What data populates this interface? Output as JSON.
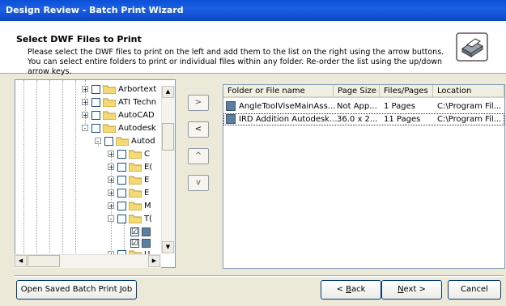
{
  "window": {
    "title": "Design Review - Batch Print Wizard"
  },
  "header": {
    "title": "Select DWF Files to Print",
    "description": "Please select the DWF files to print on the left and add them to the list on the right using the arrow buttons.  You can select entire folders to print or individual files within any folder.  Re-order the list using the up/down arrow keys.",
    "icon": "printer-icon"
  },
  "tree": {
    "items": [
      {
        "label": "Arbortext",
        "expander": "+"
      },
      {
        "label": "ATI Techn",
        "expander": "+"
      },
      {
        "label": "AutoCAD",
        "expander": "+"
      },
      {
        "label": "Autodesk",
        "expander": "-"
      },
      {
        "label": "Autod",
        "expander": "-"
      },
      {
        "label": "C",
        "expander": "+"
      },
      {
        "label": "E(",
        "expander": "+"
      },
      {
        "label": "E",
        "expander": "+"
      },
      {
        "label": "E",
        "expander": "+"
      },
      {
        "label": "M",
        "expander": "+"
      },
      {
        "label": "T(",
        "expander": "-"
      },
      {
        "label": "",
        "checked": "☑"
      },
      {
        "label": "",
        "checked": "☑"
      },
      {
        "label": "U",
        "expander": "+"
      }
    ]
  },
  "arrows": {
    "add": ">",
    "remove": "<",
    "up": "^",
    "down": "v"
  },
  "list": {
    "columns": [
      "Folder or File name",
      "Page Size",
      "Files/Pages",
      "Location"
    ],
    "rows": [
      {
        "name": "AngleToolViseMainAss...",
        "size": "Not App...",
        "pages": "1 Pages",
        "location": "C:\\Program Fil..."
      },
      {
        "name": "IRD Addition Autodesk...",
        "size": "36.0 x 2...",
        "pages": "11 Pages",
        "location": "C:\\Program Fil..."
      }
    ]
  },
  "buttons": {
    "open_saved": "Open Saved Batch Print Job",
    "back_u": "B",
    "back_rest": "ack",
    "back_prefix": "< ",
    "next_u": "N",
    "next_rest": "ext >",
    "cancel": "Cancel"
  }
}
